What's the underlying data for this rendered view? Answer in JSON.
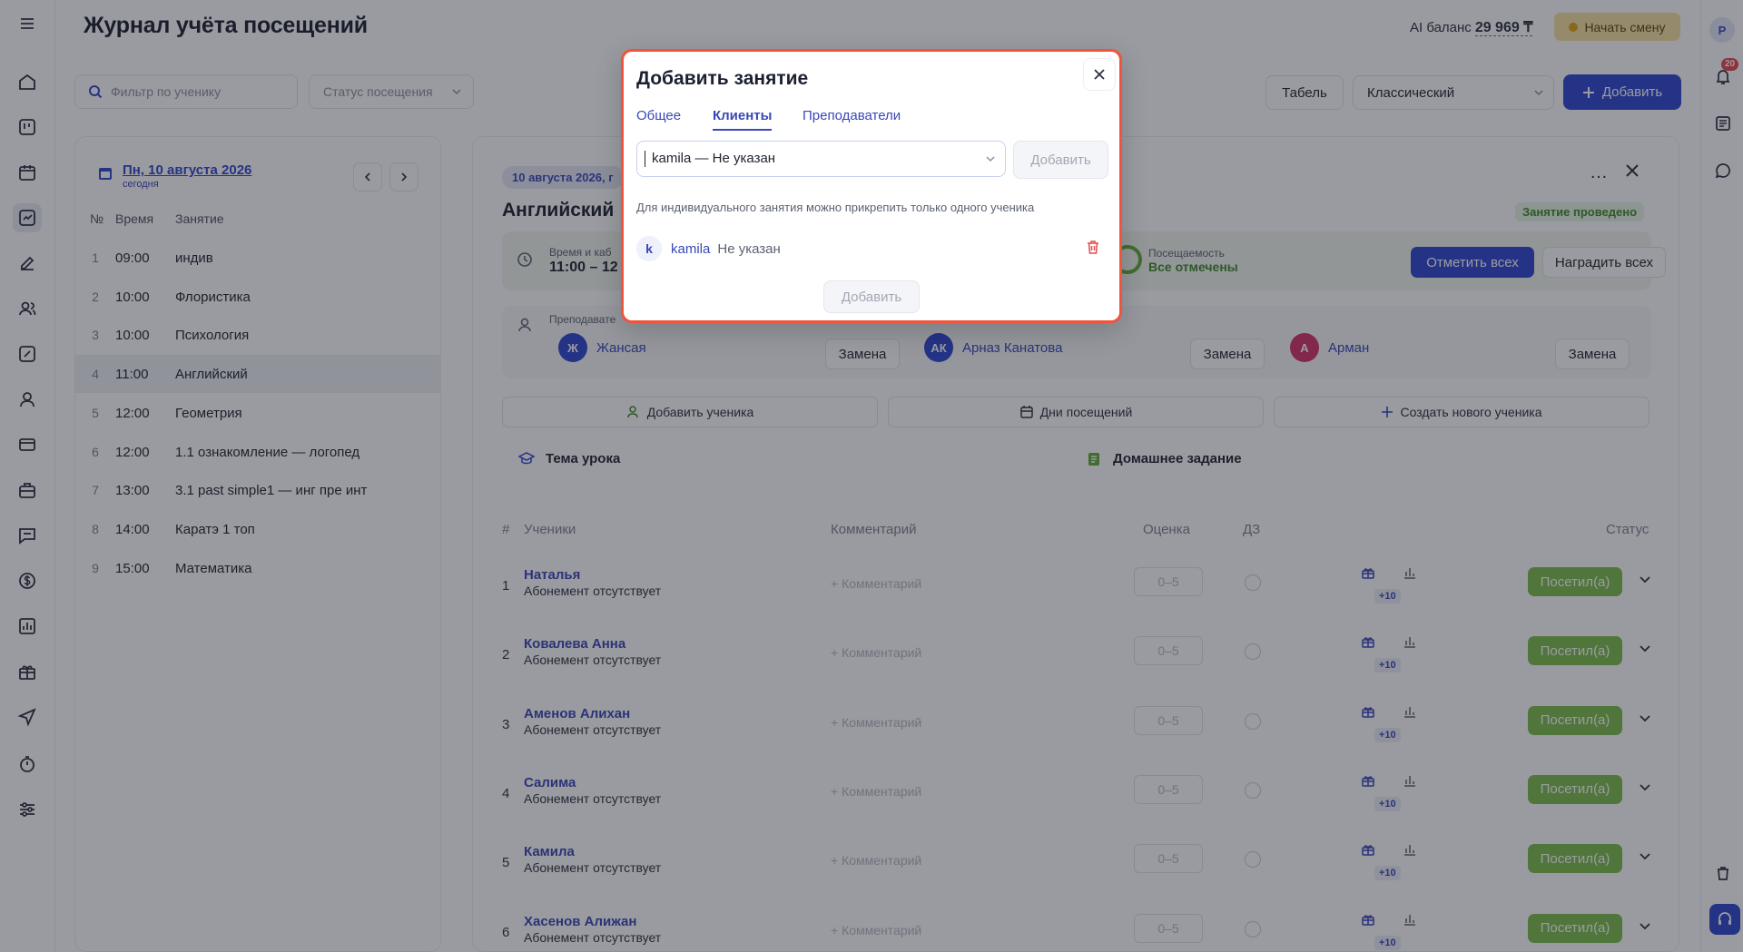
{
  "header": {
    "title": "Журнал учёта посещений",
    "ai_balance_label": "AI баланс",
    "ai_balance_value": "29 969 ₸",
    "start_shift": "Начать смену"
  },
  "toolbar": {
    "filter_placeholder": "Фильтр по ученику",
    "status_placeholder": "Статус посещения",
    "tabel": "Табель",
    "view_mode": "Классический",
    "add": "Добавить"
  },
  "right_rail": {
    "avatar_letter": "P",
    "notifications_count": "20"
  },
  "schedule": {
    "date": "Пн, 10 августа 2026",
    "today": "сегодня",
    "headers": [
      "№",
      "Время",
      "Занятие"
    ],
    "rows": [
      {
        "n": "1",
        "time": "09:00",
        "subject": "индив"
      },
      {
        "n": "2",
        "time": "10:00",
        "subject": "Флористика"
      },
      {
        "n": "3",
        "time": "10:00",
        "subject": "Психология"
      },
      {
        "n": "4",
        "time": "11:00",
        "subject": "Английский"
      },
      {
        "n": "5",
        "time": "12:00",
        "subject": "Геометрия"
      },
      {
        "n": "6",
        "time": "12:00",
        "subject": "1.1 ознакомление — логопед"
      },
      {
        "n": "7",
        "time": "13:00",
        "subject": "3.1 past simple1 — инг пре инт"
      },
      {
        "n": "8",
        "time": "14:00",
        "subject": "Каратэ 1 топ"
      },
      {
        "n": "9",
        "time": "15:00",
        "subject": "Математика"
      }
    ]
  },
  "lesson": {
    "date_pill": "10 августа 2026, г",
    "title": "Английский",
    "done_badge": "Занятие проведено",
    "time_label": "Время и каб",
    "time_value": "11:00 – 12",
    "attendance_label": "Посещаемость",
    "attendance_value": "Все отмечены",
    "mark_all": "Отметить всех",
    "reward_all": "Наградить всех",
    "teachers_label": "Преподавате",
    "teachers": [
      {
        "initials": "Ж",
        "name": "Жансая",
        "color": "#2f46d0"
      },
      {
        "initials": "АК",
        "name": "Арназ Канатова",
        "color": "#2f46d0"
      },
      {
        "initials": "А",
        "name": "Арман",
        "color": "#d6336c"
      }
    ],
    "replace": "Замена",
    "actions": {
      "add_student": "Добавить ученика",
      "visit_days": "Дни посещений",
      "create_student": "Создать нового ученика"
    },
    "topic": "Тема урока",
    "homework": "Домашнее задание",
    "columns": {
      "num": "#",
      "students": "Ученики",
      "comment": "Комментарий",
      "grade": "Оценка",
      "hw": "ДЗ",
      "status": "Статус"
    },
    "students": [
      {
        "n": "1",
        "name": "Наталья",
        "sub": "Абонемент отсутствует"
      },
      {
        "n": "2",
        "name": "Ковалева Анна",
        "sub": "Абонемент отсутствует"
      },
      {
        "n": "3",
        "name": "Аменов Алихан",
        "sub": "Абонемент отсутствует"
      },
      {
        "n": "4",
        "name": "Салима",
        "sub": "Абонемент отсутствует"
      },
      {
        "n": "5",
        "name": "Камила",
        "sub": "Абонемент отсутствует"
      },
      {
        "n": "6",
        "name": "Хасенов Алижан",
        "sub": "Абонемент отсутствует"
      }
    ],
    "comment_placeholder": "+ Комментарий",
    "grade_placeholder": "0–5",
    "bonus": "+10",
    "status_value": "Посетил(а)"
  },
  "modal": {
    "title": "Добавить занятие",
    "tabs": [
      "Общее",
      "Клиенты",
      "Преподаватели"
    ],
    "active_tab": "Клиенты",
    "select_value": "kamila — Не указан",
    "add_small": "Добавить",
    "hint": "Для индивидуального занятия можно прикрепить только одного ученика",
    "client_initial": "k",
    "client_name": "kamila",
    "client_status": "Не указан",
    "add_button": "Добавить"
  },
  "colors": {
    "accent": "#2f46d0",
    "success": "#7bbd4b",
    "danger": "#e5484d",
    "shift": "#f7e3a2",
    "modal_border": "#f0543c"
  }
}
